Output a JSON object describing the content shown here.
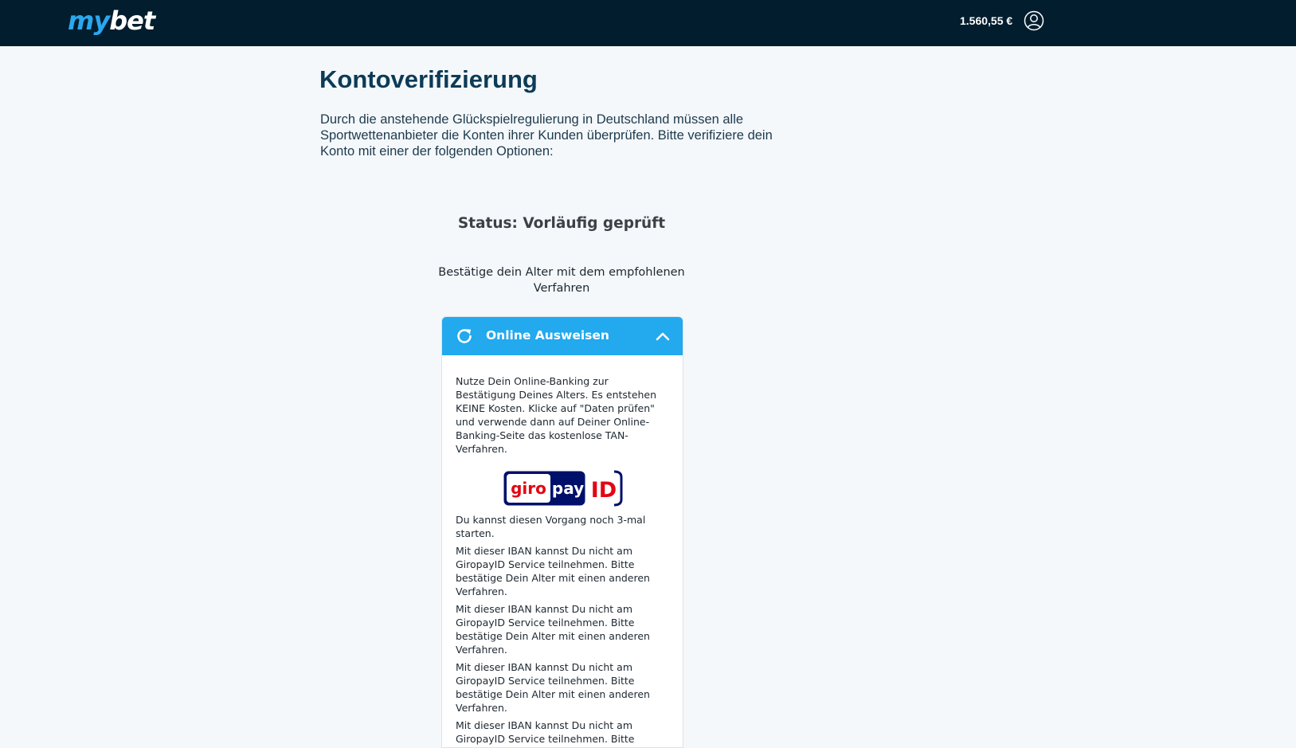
{
  "header": {
    "logo_my": "my",
    "logo_bet": "bet",
    "balance": "1.560,55  €",
    "user_icon": "user-circle-icon"
  },
  "main": {
    "title": "Kontoverifizierung",
    "intro": "Durch die anstehende Glückspielregulierung in Deutschland müssen alle Sportwettenanbieter die Konten ihrer Kunden überprüfen. Bitte verifiziere dein Konto mit einer der folgenden Optionen:",
    "status": "Status: Vorläufig geprüft",
    "recommend": "Bestätige dein Alter mit dem empfohlenen Verfahren"
  },
  "card": {
    "title": "Online Ausweisen",
    "header_icon": "refresh-icon",
    "toggle_icon": "chevron-up-icon",
    "description": "Nutze Dein Online-Banking zur Bestätigung Deines Alters. Es entstehen KEINE Kosten. Klicke auf \"Daten prüfen\" und verwende dann auf Deiner Online-Banking-Seite das kostenlose TAN-Verfahren.",
    "logo": {
      "giro": "giro",
      "pay": "pay",
      "id": "ID"
    },
    "attempts": "Du kannst diesen Vorgang noch 3-mal starten.",
    "errors": [
      "Mit dieser IBAN kannst Du nicht am GiropayID Service teilnehmen. Bitte bestätige Dein Alter mit einen anderen Verfahren.",
      "Mit dieser IBAN kannst Du nicht am GiropayID Service teilnehmen. Bitte bestätige Dein Alter mit einen anderen Verfahren.",
      "Mit dieser IBAN kannst Du nicht am GiropayID Service teilnehmen. Bitte bestätige Dein Alter mit einen anderen Verfahren.",
      "Mit dieser IBAN kannst Du nicht am GiropayID Service teilnehmen. Bitte bestätige Dein Alter mit einen anderen Verfahren."
    ]
  },
  "colors": {
    "topbar": "#021d2e",
    "accent": "#22a9ee",
    "title": "#0c3b57",
    "giro_red": "#e30613",
    "giro_navy": "#000f6a"
  }
}
